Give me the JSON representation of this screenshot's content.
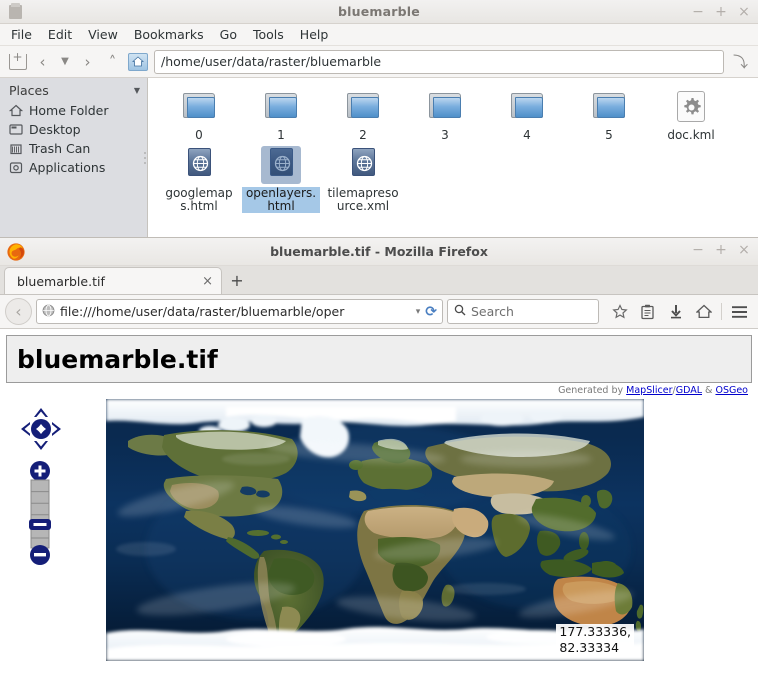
{
  "file_manager": {
    "title": "bluemarble",
    "window_buttons": {
      "minimize": "−",
      "maximize": "+",
      "close": "×"
    },
    "menu": [
      "File",
      "Edit",
      "View",
      "Bookmarks",
      "Go",
      "Tools",
      "Help"
    ],
    "toolbar": {
      "new_tab": "new-tab",
      "back": "‹",
      "history_dropdown": "▼",
      "forward": "›",
      "up": "˄",
      "home": "home-icon",
      "path_value": "/home/user/data/raster/bluemarble",
      "go_button": "⤵"
    },
    "sidebar": {
      "header": "Places",
      "collapse_caret": "▼",
      "items": [
        {
          "label": "Home Folder",
          "icon": "home-icon"
        },
        {
          "label": "Desktop",
          "icon": "desktop-icon"
        },
        {
          "label": "Trash Can",
          "icon": "trash-icon"
        },
        {
          "label": "Applications",
          "icon": "applications-icon"
        }
      ]
    },
    "files": [
      {
        "label": "0",
        "type": "folder",
        "selected": false
      },
      {
        "label": "1",
        "type": "folder",
        "selected": false
      },
      {
        "label": "2",
        "type": "folder",
        "selected": false
      },
      {
        "label": "3",
        "type": "folder",
        "selected": false
      },
      {
        "label": "4",
        "type": "folder",
        "selected": false
      },
      {
        "label": "5",
        "type": "folder",
        "selected": false
      },
      {
        "label": "doc.kml",
        "type": "gear-document",
        "selected": false
      },
      {
        "label": "googlemaps.html",
        "type": "globe-document",
        "selected": false
      },
      {
        "label": "openlayers.html",
        "type": "globe-document",
        "selected": true
      },
      {
        "label": "tilemapresource.xml",
        "type": "globe-document",
        "selected": false
      }
    ]
  },
  "firefox": {
    "title": "bluemarble.tif - Mozilla Firefox",
    "window_buttons": {
      "minimize": "−",
      "maximize": "+",
      "close": "×"
    },
    "tabs": [
      {
        "label": "bluemarble.tif",
        "close": "×",
        "active": true
      }
    ],
    "new_tab_label": "+",
    "nav": {
      "back": "‹",
      "url_value": "file:///home/user/data/raster/bluemarble/oper",
      "url_caret": "▾",
      "reload": "⟳",
      "search_placeholder": "Search",
      "icons": [
        "star-icon",
        "library-icon",
        "downloads-icon",
        "home-icon",
        "menu-icon"
      ]
    },
    "page": {
      "title": "bluemarble.tif",
      "credits_prefix": "Generated by ",
      "credits_links": [
        {
          "label": "MapSlicer"
        },
        {
          "label": "GDAL"
        },
        {
          "label": "OSGeo"
        }
      ],
      "credits_sep1": "/",
      "credits_sep2": " & ",
      "map": {
        "pan_control": "pan-control",
        "zoom_in": "+",
        "zoom_out": "−",
        "zoom_levels": 6,
        "zoom_current": 4,
        "coordinates": "177.33336, 82.33334",
        "layer": "blue-marble-world-imagery"
      }
    }
  },
  "colors": {
    "selection_blue": "#a5c8e7",
    "link_blue": "#0000cc",
    "control_navy": "#141e78",
    "folder_blue": "#4f8fc9",
    "ocean_deep": "#06203f"
  }
}
